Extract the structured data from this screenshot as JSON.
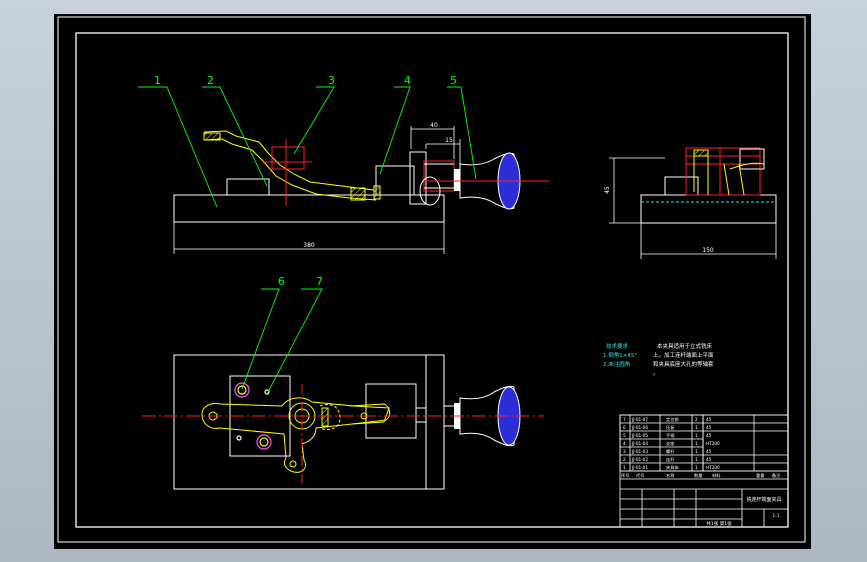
{
  "colors": {
    "background": "#000000",
    "frame": "#ffffff",
    "outline": "#ffffff",
    "leader": "#00ff00",
    "centerline": "#ff2020",
    "part": "#ffff00",
    "knob": "#3333dd",
    "hole": "#ff55ff",
    "dimension": "#30e0e0"
  },
  "balloons": [
    "1",
    "2",
    "3",
    "4",
    "5",
    "6",
    "7"
  ],
  "dimensions": {
    "front_length": "380",
    "front_offset_a": "40",
    "front_offset_b": "15",
    "side_height": "45",
    "side_width": "150"
  },
  "notes": {
    "heading": "技术要求",
    "item1": "1.倒角1×45°",
    "item2": "2.未注圆角",
    "text1": "本夹具适用于立式铣床",
    "text2": "上，加工连杆端面上平面",
    "text3": "和夹具底座大孔的等轴套",
    "text4": "。"
  },
  "title_block": {
    "bom_rows": [
      {
        "no": "7",
        "code": "JJ-01-07",
        "name": "定位销",
        "qty": "2",
        "material": "45"
      },
      {
        "no": "6",
        "code": "JJ-01-06",
        "name": "压板",
        "qty": "1",
        "material": "45"
      },
      {
        "no": "5",
        "code": "JJ-01-05",
        "name": "手柄",
        "qty": "1",
        "material": "45"
      },
      {
        "no": "4",
        "code": "JJ-01-04",
        "name": "支座",
        "qty": "1",
        "material": "HT200"
      },
      {
        "no": "3",
        "code": "JJ-01-03",
        "name": "螺杆",
        "qty": "1",
        "material": "45"
      },
      {
        "no": "2",
        "code": "JJ-01-02",
        "name": "连杆",
        "qty": "1",
        "material": "45"
      },
      {
        "no": "1",
        "code": "JJ-01-01",
        "name": "夹具体",
        "qty": "1",
        "material": "HT200"
      }
    ],
    "header": {
      "no": "序号",
      "code": "代号",
      "name": "名称",
      "qty": "数量",
      "material": "材料",
      "weight": "重量",
      "remark": "备注"
    },
    "drawing_title": "铣连杆端面夹具",
    "scale": "1:1",
    "sheet": "共1张 第1张"
  }
}
